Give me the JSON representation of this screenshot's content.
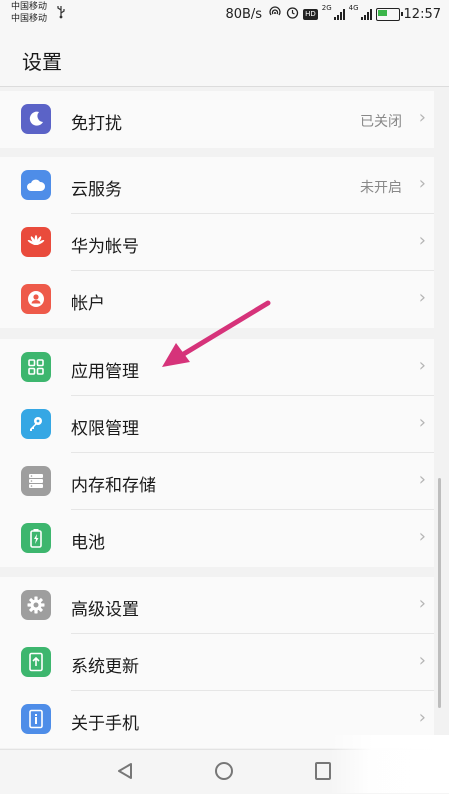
{
  "status_bar": {
    "carrier_1": "中国移动",
    "carrier_2": "中国移动",
    "usb_icon": "usb-icon",
    "net_speed": "80B/s",
    "net_1": "2G",
    "net_2": "4G",
    "hd_label": "HD",
    "time": "12:57"
  },
  "header": {
    "title": "设置"
  },
  "groups": [
    {
      "items": [
        {
          "label": "免打扰",
          "value": "已关闭",
          "icon": "moon-icon",
          "color": "#5b63c7"
        }
      ]
    },
    {
      "items": [
        {
          "label": "云服务",
          "value": "未开启",
          "icon": "cloud-icon",
          "color": "#4e8de8"
        },
        {
          "label": "华为帐号",
          "value": "",
          "icon": "huawei-logo-icon",
          "color": "#e94b3c"
        },
        {
          "label": "帐户",
          "value": "",
          "icon": "account-icon",
          "color": "#ee5a4a"
        }
      ]
    },
    {
      "items": [
        {
          "label": "应用管理",
          "value": "",
          "icon": "apps-grid-icon",
          "color": "#3db66e"
        },
        {
          "label": "权限管理",
          "value": "",
          "icon": "key-icon",
          "color": "#35a7e4"
        },
        {
          "label": "内存和存储",
          "value": "",
          "icon": "storage-icon",
          "color": "#9e9e9e"
        },
        {
          "label": "电池",
          "value": "",
          "icon": "battery-icon",
          "color": "#3db66e"
        }
      ]
    },
    {
      "items": [
        {
          "label": "高级设置",
          "value": "",
          "icon": "gear-icon",
          "color": "#9e9e9e"
        },
        {
          "label": "系统更新",
          "value": "",
          "icon": "system-update-icon",
          "color": "#3db66e"
        },
        {
          "label": "关于手机",
          "value": "",
          "icon": "info-icon",
          "color": "#4e8de8"
        }
      ]
    }
  ],
  "annotation": {
    "arrow_color": "#d6337a"
  }
}
